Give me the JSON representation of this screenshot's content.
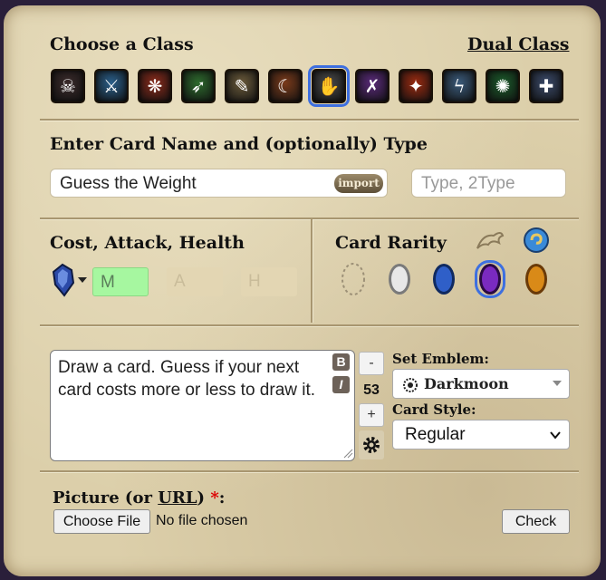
{
  "headings": {
    "choose_class": "Choose a Class",
    "dual_class": "Dual Class",
    "card_name": "Enter Card Name and (optionally) Type",
    "cost_attack_health": "Cost, Attack, Health",
    "card_rarity": "Card Rarity",
    "set_emblem": "Set Emblem:",
    "card_style": "Card Style:"
  },
  "classes": [
    {
      "icon": "demon-hunter-icon",
      "color": "#3a2a2a"
    },
    {
      "icon": "sword-icon",
      "color": "#2a5f8a"
    },
    {
      "icon": "paw-icon",
      "color": "#8a2a1a"
    },
    {
      "icon": "bow-icon",
      "color": "#2d6a2d"
    },
    {
      "icon": "book-icon",
      "color": "#6a5a3a"
    },
    {
      "icon": "scythe-icon",
      "color": "#7a3a1a"
    },
    {
      "icon": "claw-icon",
      "color": "#4a4a4a",
      "selected": true
    },
    {
      "icon": "crossed-blades-icon",
      "color": "#5a2a7a"
    },
    {
      "icon": "fire-staff-icon",
      "color": "#9a2a10"
    },
    {
      "icon": "lightning-icon",
      "color": "#3a5a7a"
    },
    {
      "icon": "fel-icon",
      "color": "#1a5a2a"
    },
    {
      "icon": "mace-icon",
      "color": "#3a4a6a"
    }
  ],
  "card": {
    "name": "Guess the Weight",
    "import_label": "import",
    "type_placeholder": "Type, 2Type",
    "mana_placeholder": "M",
    "attack_placeholder": "A",
    "health_placeholder": "H",
    "description": "Draw a card. Guess if your next card costs more or less to draw it.",
    "cost_value": "53",
    "bold_label": "B",
    "italic_label": "I",
    "minus_label": "-",
    "plus_label": "+"
  },
  "rarity": {
    "options": [
      {
        "name": "none",
        "color": "#c9bc9a"
      },
      {
        "name": "common",
        "color": "#d9d9d9"
      },
      {
        "name": "rare",
        "color": "#1f4fa8"
      },
      {
        "name": "epic",
        "color": "#6a1fa0",
        "selected": true
      },
      {
        "name": "legendary",
        "color": "#c47a10"
      }
    ]
  },
  "emblem": {
    "selected": "Darkmoon"
  },
  "style": {
    "selected": "Regular"
  },
  "picture": {
    "label_prefix": "Picture (or ",
    "url_label": "URL",
    "label_suffix": ")",
    "required_mark": "*",
    "colon": ":",
    "choose_file_label": "Choose File",
    "no_file_text": "No file chosen",
    "check_label": "Check"
  }
}
